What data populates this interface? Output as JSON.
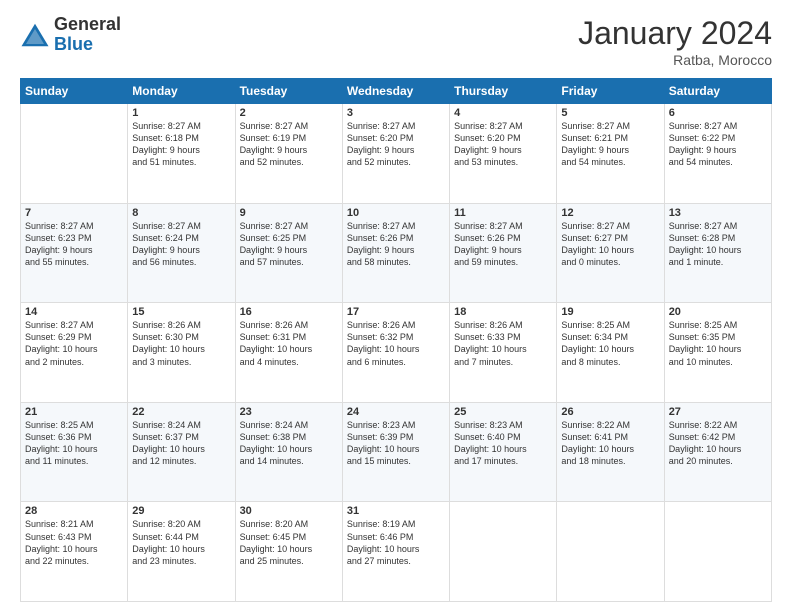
{
  "logo": {
    "line1": "General",
    "line2": "Blue"
  },
  "title": "January 2024",
  "subtitle": "Ratba, Morocco",
  "days_of_week": [
    "Sunday",
    "Monday",
    "Tuesday",
    "Wednesday",
    "Thursday",
    "Friday",
    "Saturday"
  ],
  "weeks": [
    [
      {
        "day": "",
        "info": ""
      },
      {
        "day": "1",
        "info": "Sunrise: 8:27 AM\nSunset: 6:18 PM\nDaylight: 9 hours\nand 51 minutes."
      },
      {
        "day": "2",
        "info": "Sunrise: 8:27 AM\nSunset: 6:19 PM\nDaylight: 9 hours\nand 52 minutes."
      },
      {
        "day": "3",
        "info": "Sunrise: 8:27 AM\nSunset: 6:20 PM\nDaylight: 9 hours\nand 52 minutes."
      },
      {
        "day": "4",
        "info": "Sunrise: 8:27 AM\nSunset: 6:20 PM\nDaylight: 9 hours\nand 53 minutes."
      },
      {
        "day": "5",
        "info": "Sunrise: 8:27 AM\nSunset: 6:21 PM\nDaylight: 9 hours\nand 54 minutes."
      },
      {
        "day": "6",
        "info": "Sunrise: 8:27 AM\nSunset: 6:22 PM\nDaylight: 9 hours\nand 54 minutes."
      }
    ],
    [
      {
        "day": "7",
        "info": "Sunrise: 8:27 AM\nSunset: 6:23 PM\nDaylight: 9 hours\nand 55 minutes."
      },
      {
        "day": "8",
        "info": "Sunrise: 8:27 AM\nSunset: 6:24 PM\nDaylight: 9 hours\nand 56 minutes."
      },
      {
        "day": "9",
        "info": "Sunrise: 8:27 AM\nSunset: 6:25 PM\nDaylight: 9 hours\nand 57 minutes."
      },
      {
        "day": "10",
        "info": "Sunrise: 8:27 AM\nSunset: 6:26 PM\nDaylight: 9 hours\nand 58 minutes."
      },
      {
        "day": "11",
        "info": "Sunrise: 8:27 AM\nSunset: 6:26 PM\nDaylight: 9 hours\nand 59 minutes."
      },
      {
        "day": "12",
        "info": "Sunrise: 8:27 AM\nSunset: 6:27 PM\nDaylight: 10 hours\nand 0 minutes."
      },
      {
        "day": "13",
        "info": "Sunrise: 8:27 AM\nSunset: 6:28 PM\nDaylight: 10 hours\nand 1 minute."
      }
    ],
    [
      {
        "day": "14",
        "info": "Sunrise: 8:27 AM\nSunset: 6:29 PM\nDaylight: 10 hours\nand 2 minutes."
      },
      {
        "day": "15",
        "info": "Sunrise: 8:26 AM\nSunset: 6:30 PM\nDaylight: 10 hours\nand 3 minutes."
      },
      {
        "day": "16",
        "info": "Sunrise: 8:26 AM\nSunset: 6:31 PM\nDaylight: 10 hours\nand 4 minutes."
      },
      {
        "day": "17",
        "info": "Sunrise: 8:26 AM\nSunset: 6:32 PM\nDaylight: 10 hours\nand 6 minutes."
      },
      {
        "day": "18",
        "info": "Sunrise: 8:26 AM\nSunset: 6:33 PM\nDaylight: 10 hours\nand 7 minutes."
      },
      {
        "day": "19",
        "info": "Sunrise: 8:25 AM\nSunset: 6:34 PM\nDaylight: 10 hours\nand 8 minutes."
      },
      {
        "day": "20",
        "info": "Sunrise: 8:25 AM\nSunset: 6:35 PM\nDaylight: 10 hours\nand 10 minutes."
      }
    ],
    [
      {
        "day": "21",
        "info": "Sunrise: 8:25 AM\nSunset: 6:36 PM\nDaylight: 10 hours\nand 11 minutes."
      },
      {
        "day": "22",
        "info": "Sunrise: 8:24 AM\nSunset: 6:37 PM\nDaylight: 10 hours\nand 12 minutes."
      },
      {
        "day": "23",
        "info": "Sunrise: 8:24 AM\nSunset: 6:38 PM\nDaylight: 10 hours\nand 14 minutes."
      },
      {
        "day": "24",
        "info": "Sunrise: 8:23 AM\nSunset: 6:39 PM\nDaylight: 10 hours\nand 15 minutes."
      },
      {
        "day": "25",
        "info": "Sunrise: 8:23 AM\nSunset: 6:40 PM\nDaylight: 10 hours\nand 17 minutes."
      },
      {
        "day": "26",
        "info": "Sunrise: 8:22 AM\nSunset: 6:41 PM\nDaylight: 10 hours\nand 18 minutes."
      },
      {
        "day": "27",
        "info": "Sunrise: 8:22 AM\nSunset: 6:42 PM\nDaylight: 10 hours\nand 20 minutes."
      }
    ],
    [
      {
        "day": "28",
        "info": "Sunrise: 8:21 AM\nSunset: 6:43 PM\nDaylight: 10 hours\nand 22 minutes."
      },
      {
        "day": "29",
        "info": "Sunrise: 8:20 AM\nSunset: 6:44 PM\nDaylight: 10 hours\nand 23 minutes."
      },
      {
        "day": "30",
        "info": "Sunrise: 8:20 AM\nSunset: 6:45 PM\nDaylight: 10 hours\nand 25 minutes."
      },
      {
        "day": "31",
        "info": "Sunrise: 8:19 AM\nSunset: 6:46 PM\nDaylight: 10 hours\nand 27 minutes."
      },
      {
        "day": "",
        "info": ""
      },
      {
        "day": "",
        "info": ""
      },
      {
        "day": "",
        "info": ""
      }
    ]
  ]
}
